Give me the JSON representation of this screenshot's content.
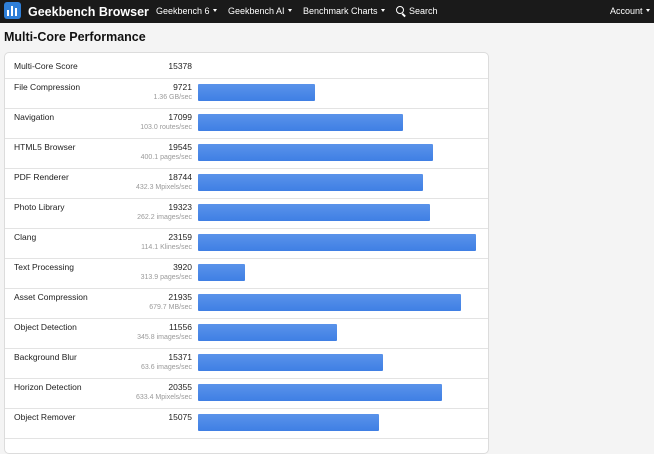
{
  "nav": {
    "brand": "Geekbench Browser",
    "items": [
      {
        "label": "Geekbench 6",
        "dropdown": true
      },
      {
        "label": "Geekbench AI",
        "dropdown": true
      },
      {
        "label": "Benchmark Charts",
        "dropdown": true
      },
      {
        "label": "Search",
        "icon": "search-icon"
      },
      {
        "label": "Account",
        "dropdown": true
      }
    ]
  },
  "page": {
    "title": "Multi-Core Performance"
  },
  "summary": {
    "label": "Multi-Core Score",
    "value": "15378"
  },
  "max_score": 23159,
  "rows": [
    {
      "name": "File Compression",
      "score": "9721",
      "unit": "1.36 GB/sec"
    },
    {
      "name": "Navigation",
      "score": "17099",
      "unit": "103.0 routes/sec"
    },
    {
      "name": "HTML5 Browser",
      "score": "19545",
      "unit": "400.1 pages/sec"
    },
    {
      "name": "PDF Renderer",
      "score": "18744",
      "unit": "432.3 Mpixels/sec"
    },
    {
      "name": "Photo Library",
      "score": "19323",
      "unit": "262.2 images/sec"
    },
    {
      "name": "Clang",
      "score": "23159",
      "unit": "114.1 Klines/sec"
    },
    {
      "name": "Text Processing",
      "score": "3920",
      "unit": "313.9 pages/sec"
    },
    {
      "name": "Asset Compression",
      "score": "21935",
      "unit": "679.7 MB/sec"
    },
    {
      "name": "Object Detection",
      "score": "11556",
      "unit": "345.8 images/sec"
    },
    {
      "name": "Background Blur",
      "score": "15371",
      "unit": "63.6 images/sec"
    },
    {
      "name": "Horizon Detection",
      "score": "20355",
      "unit": "633.4 Mpixels/sec"
    },
    {
      "name": "Object Remover",
      "score": "15075",
      "unit": ""
    }
  ],
  "colors": {
    "navbar": "#1a1a1a",
    "bar": "#4a86e8",
    "logo": "#2f7fd8"
  }
}
